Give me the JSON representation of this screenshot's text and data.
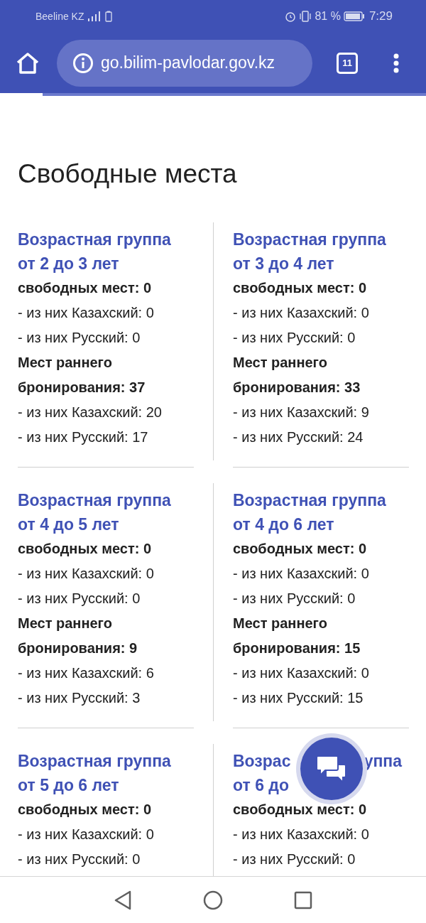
{
  "status_bar": {
    "carrier": "Beeline KZ",
    "battery": "81 %",
    "time": "7:29"
  },
  "browser": {
    "url": "go.bilim-pavlodar.gov.kz",
    "tab_count": "11",
    "load_progress": {
      "level": 0.1
    }
  },
  "heading": "Свободные места",
  "cards": [
    {
      "title_lines": [
        [
          "Возрастная группа"
        ],
        [
          "от 2 до 3 лет"
        ]
      ],
      "free": "свободных мест: 0",
      "free_details": [
        "- из них Казахский: 0",
        "- из них Русский: 0"
      ],
      "early": "Мест раннего бронирования: 37",
      "early_details": [
        "- из них Казахский: 20",
        "- из них Русский: 17"
      ]
    },
    {
      "title_lines": [
        [
          "Возрастная группа"
        ],
        [
          "от 3 до 4 лет"
        ]
      ],
      "free": "свободных мест: 0",
      "free_details": [
        "- из них Казахский: 0",
        "- из них Русский: 0"
      ],
      "early": "Мест раннего бронирования: 33",
      "early_details": [
        "- из них Казахский: 9",
        "- из них Русский: 24"
      ]
    },
    {
      "title_lines": [
        [
          "Возрастная группа"
        ],
        [
          "от 4 до 5 лет"
        ]
      ],
      "free": "свободных мест: 0",
      "free_details": [
        "- из них Казахский: 0",
        "- из них Русский: 0"
      ],
      "early": "Мест раннего бронирования: 9",
      "early_details": [
        "- из них Казахский: 6",
        "- из них Русский: 3"
      ]
    },
    {
      "title_lines": [
        [
          "Возрастная группа"
        ],
        [
          "от 4 до 6 лет"
        ]
      ],
      "free": "свободных мест: 0",
      "free_details": [
        "- из них Казахский: 0",
        "- из них Русский: 0"
      ],
      "early": "Мест раннего бронирования: 15",
      "early_details": [
        "- из них Казахский: 0",
        "- из них Русский: 15"
      ]
    },
    {
      "title_lines": [
        [
          "Возрастная группа"
        ],
        [
          "от 5 до 6 лет"
        ]
      ],
      "free": "свободных мест: 0",
      "free_details": [
        "- из них Казахский: 0",
        "- из них Русский: 0"
      ]
    },
    {
      "title_lines": [
        [
          "Возрас",
          "уппа"
        ],
        [
          "от 6 до"
        ]
      ],
      "free": "свободных мест: 0",
      "free_details": [
        "- из них Казахский: 0",
        "- из них Русский: 0"
      ]
    }
  ]
}
